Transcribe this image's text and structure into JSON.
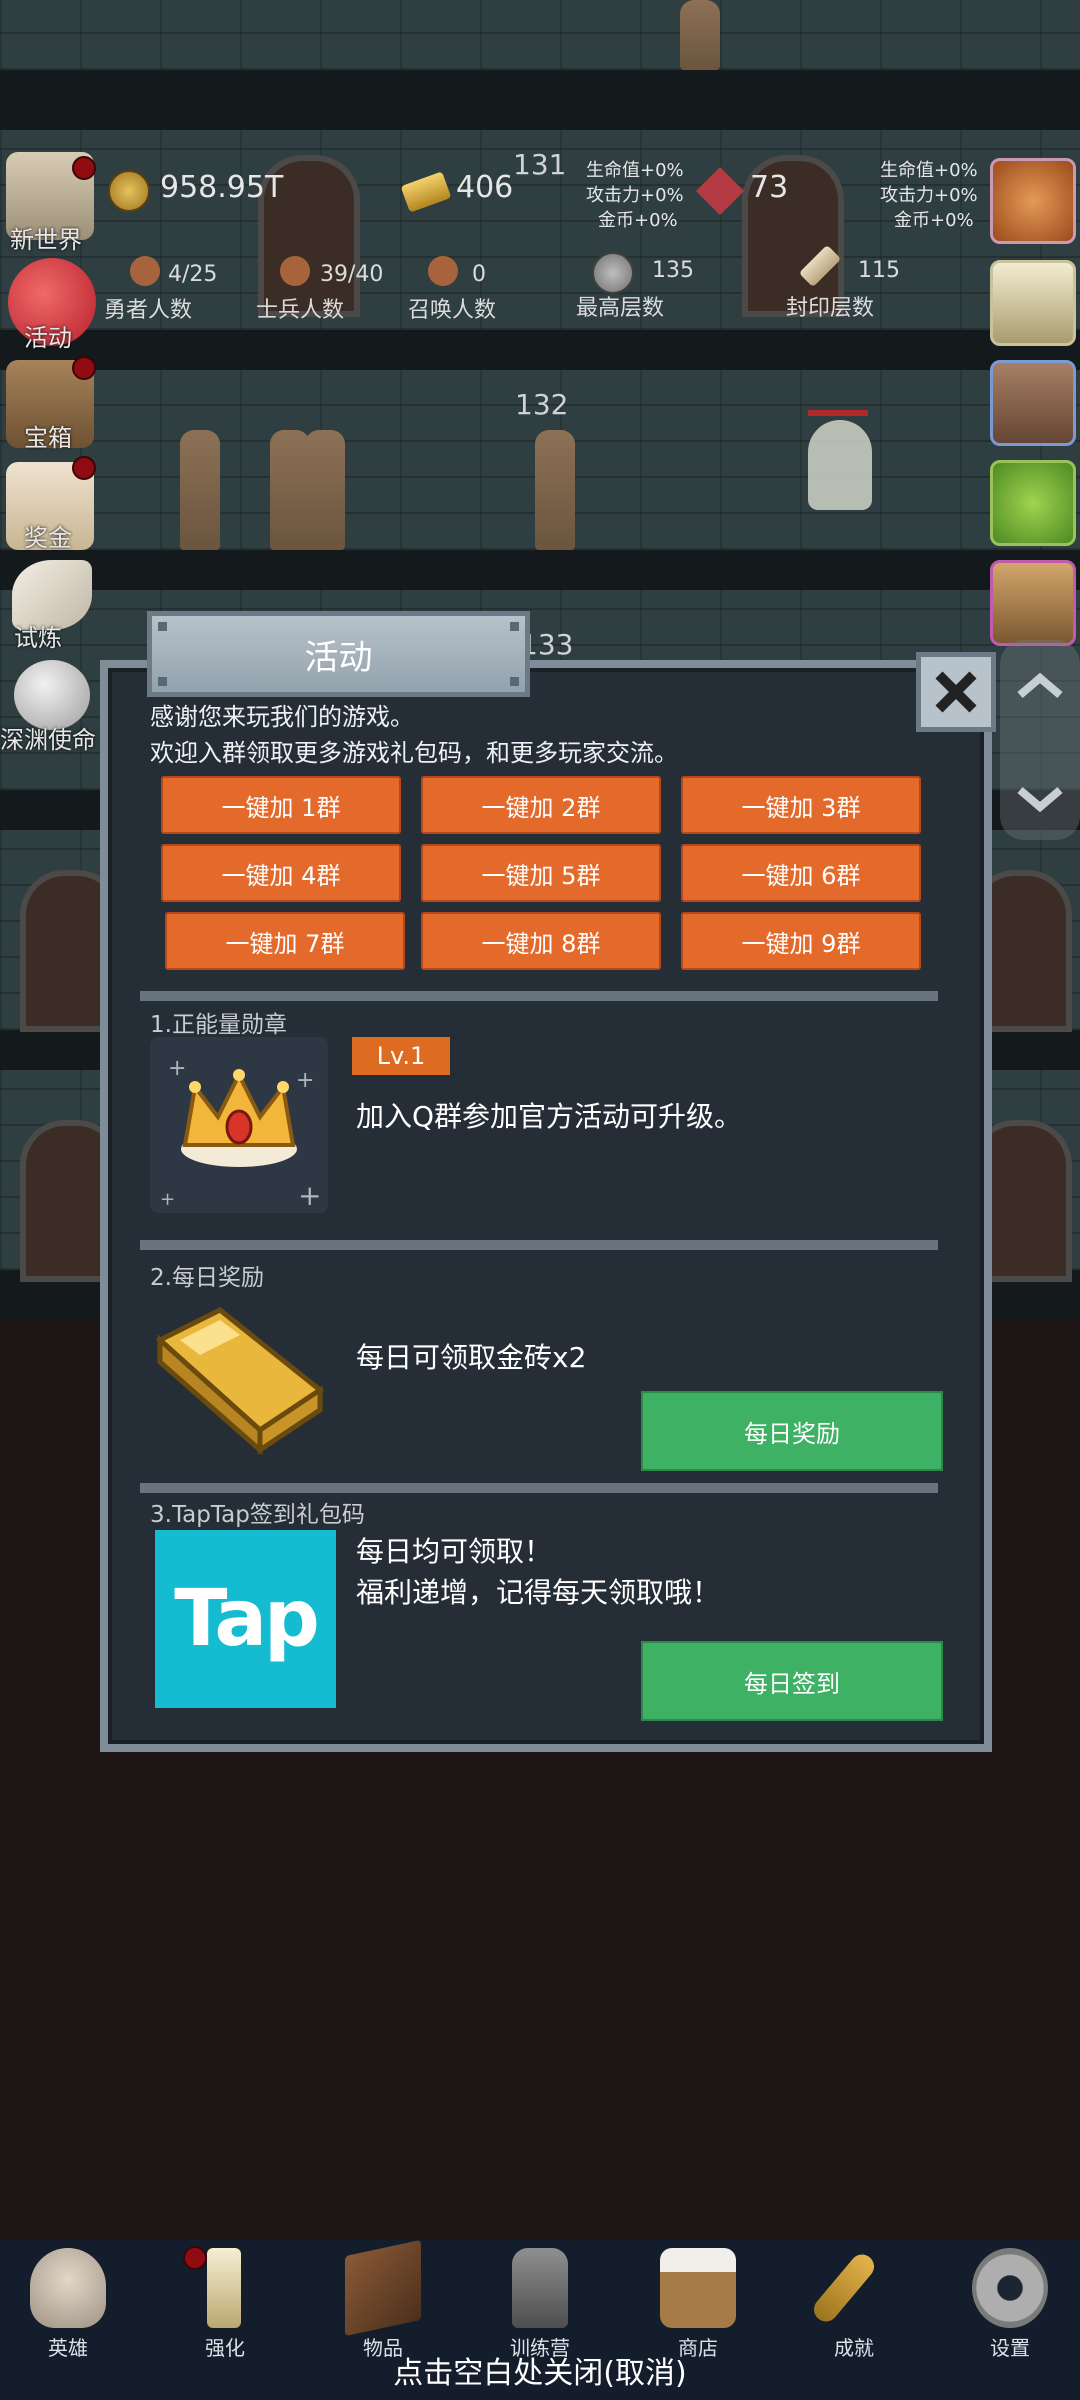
{
  "stats": {
    "gold": "958.95T",
    "gold_bars": "406",
    "gems": "73",
    "bars_floor": "131",
    "bonus_left": [
      "生命值+0%",
      "攻击力+0%",
      "金币+0%"
    ],
    "bonus_right": [
      "生命值+0%",
      "攻击力+0%",
      "金币+0%"
    ],
    "heroes": {
      "value": "4/25",
      "label": "勇者人数"
    },
    "soldiers": {
      "value": "39/40",
      "label": "士兵人数"
    },
    "summons": {
      "value": "0",
      "label": "召唤人数"
    },
    "max_floor": {
      "value": "135",
      "label": "最高层数"
    },
    "sealed_floor": {
      "value": "115",
      "label": "封印层数"
    }
  },
  "floors": {
    "f132": "132",
    "f133": "133"
  },
  "side_menu": [
    {
      "label": "新世界",
      "dot": true
    },
    {
      "label": "活动",
      "dot": false
    },
    {
      "label": "宝箱",
      "dot": true
    },
    {
      "label": "奖金",
      "dot": true
    },
    {
      "label": "试炼",
      "dot": false
    },
    {
      "label": "深渊使命",
      "dot": false
    }
  ],
  "modal": {
    "title": "活动",
    "intro_1": "感谢您来玩我们的游戏。",
    "intro_2": "欢迎入群领取更多游戏礼包码，和更多玩家交流。",
    "group_buttons": [
      "一键加 1群",
      "一键加 2群",
      "一键加 3群",
      "一键加 4群",
      "一键加 5群",
      "一键加 6群",
      "一键加 7群",
      "一键加 8群",
      "一键加 9群"
    ],
    "section1": {
      "title": "1.正能量勋章",
      "level": "Lv.1",
      "desc": "加入Q群参加官方活动可升级。"
    },
    "section2": {
      "title": "2.每日奖励",
      "desc": "每日可领取金砖x2",
      "button": "每日奖励"
    },
    "section3": {
      "title": "3.TapTap签到礼包码",
      "desc_1": "每日均可领取！",
      "desc_2": "福利递增，记得每天领取哦！",
      "button": "每日签到",
      "logo_text": "Tap"
    }
  },
  "nav": [
    {
      "label": "英雄",
      "icon": "skull-icon"
    },
    {
      "label": "强化",
      "icon": "candle-icon",
      "dot": true
    },
    {
      "label": "物品",
      "icon": "book-icon"
    },
    {
      "label": "训练营",
      "icon": "lantern-icon"
    },
    {
      "label": "商店",
      "icon": "beer-mug-icon"
    },
    {
      "label": "成就",
      "icon": "key-icon"
    },
    {
      "label": "设置",
      "icon": "gear-icon"
    }
  ],
  "close_hint": "点击空白处关闭(取消)",
  "colors": {
    "orange": "#e46a2c",
    "green": "#3fb165",
    "panel": "#252d37",
    "tap": "#15bbd0"
  }
}
